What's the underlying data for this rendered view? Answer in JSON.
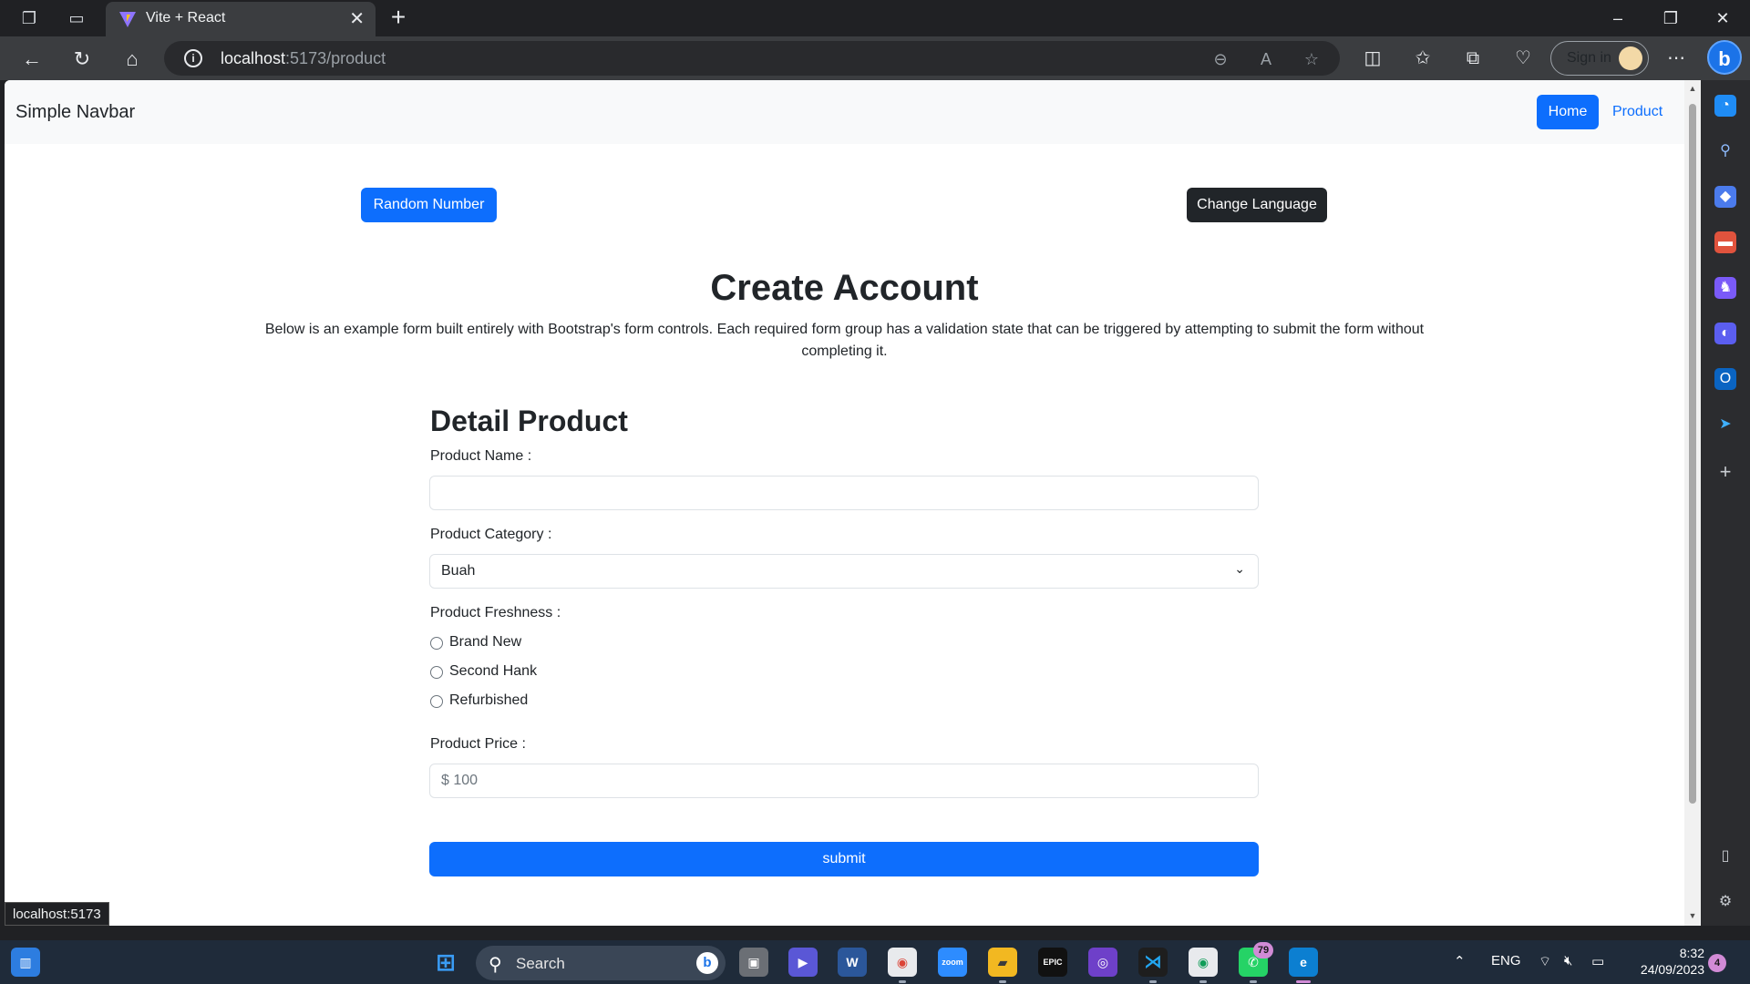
{
  "browser": {
    "tab_title": "Vite + React",
    "url_host": "localhost",
    "url_rest": ":5173/product",
    "sign_in_label": "Sign in",
    "status_url": "localhost:5173"
  },
  "navbar": {
    "brand": "Simple Navbar",
    "home_label": "Home",
    "product_label": "Product"
  },
  "actions": {
    "random_label": "Random Number",
    "language_label": "Change Language"
  },
  "header": {
    "title": "Create Account",
    "description": "Below is an example form built entirely with Bootstrap's form controls. Each required form group has a validation state that can be triggered by attempting to submit the form without completing it."
  },
  "form": {
    "title": "Detail Product",
    "name_label": "Product Name :",
    "name_value": "",
    "category_label": "Product Category :",
    "category_value": "Buah",
    "freshness_label": "Product Freshness :",
    "freshness_options": [
      "Brand New",
      "Second Hank",
      "Refurbished"
    ],
    "price_label": "Product Price :",
    "price_placeholder": "$ 100",
    "submit_label": "submit"
  },
  "taskbar": {
    "search_label": "Search",
    "language": "ENG",
    "time": "8:32",
    "date": "24/09/2023",
    "notification_count": "4",
    "whatsapp_badge": "79"
  },
  "colors": {
    "primary": "#0d6efd",
    "dark": "#212529",
    "navbar_bg": "#f8f9fa"
  }
}
